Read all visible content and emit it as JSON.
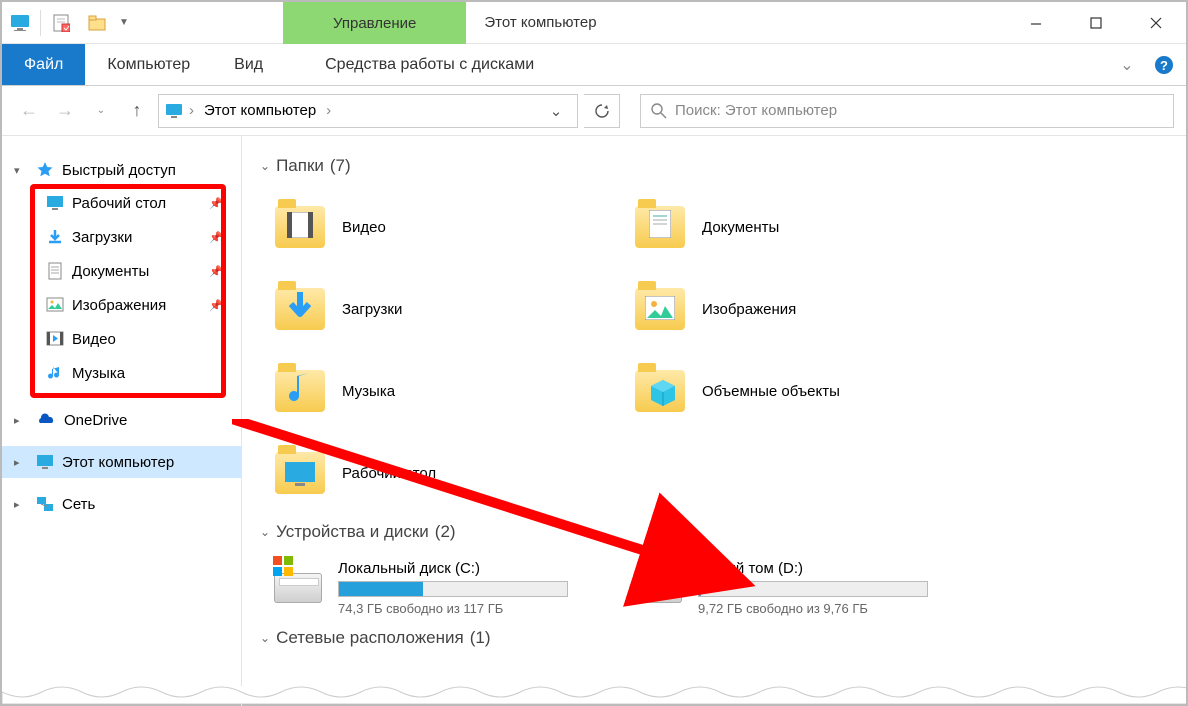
{
  "window": {
    "title": "Этот компьютер",
    "context_tab": "Управление"
  },
  "ribbon": {
    "file": "Файл",
    "computer": "Компьютер",
    "view": "Вид",
    "drive_tools": "Средства работы с дисками"
  },
  "address": {
    "crumb": "Этот компьютер",
    "search_placeholder": "Поиск: Этот компьютер"
  },
  "sidebar": {
    "quick_access": "Быстрый доступ",
    "items": [
      {
        "label": "Рабочий стол"
      },
      {
        "label": "Загрузки"
      },
      {
        "label": "Документы"
      },
      {
        "label": "Изображения"
      },
      {
        "label": "Видео"
      },
      {
        "label": "Музыка"
      }
    ],
    "onedrive": "OneDrive",
    "this_pc": "Этот компьютер",
    "network": "Сеть"
  },
  "sections": {
    "folders": {
      "title": "Папки",
      "count": "(7)"
    },
    "devices": {
      "title": "Устройства и диски",
      "count": "(2)"
    },
    "netloc": {
      "title": "Сетевые расположения",
      "count": "(1)"
    }
  },
  "folders": [
    {
      "label": "Видео"
    },
    {
      "label": "Документы"
    },
    {
      "label": "Загрузки"
    },
    {
      "label": "Изображения"
    },
    {
      "label": "Музыка"
    },
    {
      "label": "Объемные объекты"
    },
    {
      "label": "Рабочий стол"
    }
  ],
  "drives": [
    {
      "name": "Локальный диск (C:)",
      "free": "74,3 ГБ свободно из 117 ГБ",
      "fill_pct": 37
    },
    {
      "name": "Новый том (D:)",
      "free": "9,72 ГБ свободно из 9,76 ГБ",
      "fill_pct": 1
    }
  ]
}
